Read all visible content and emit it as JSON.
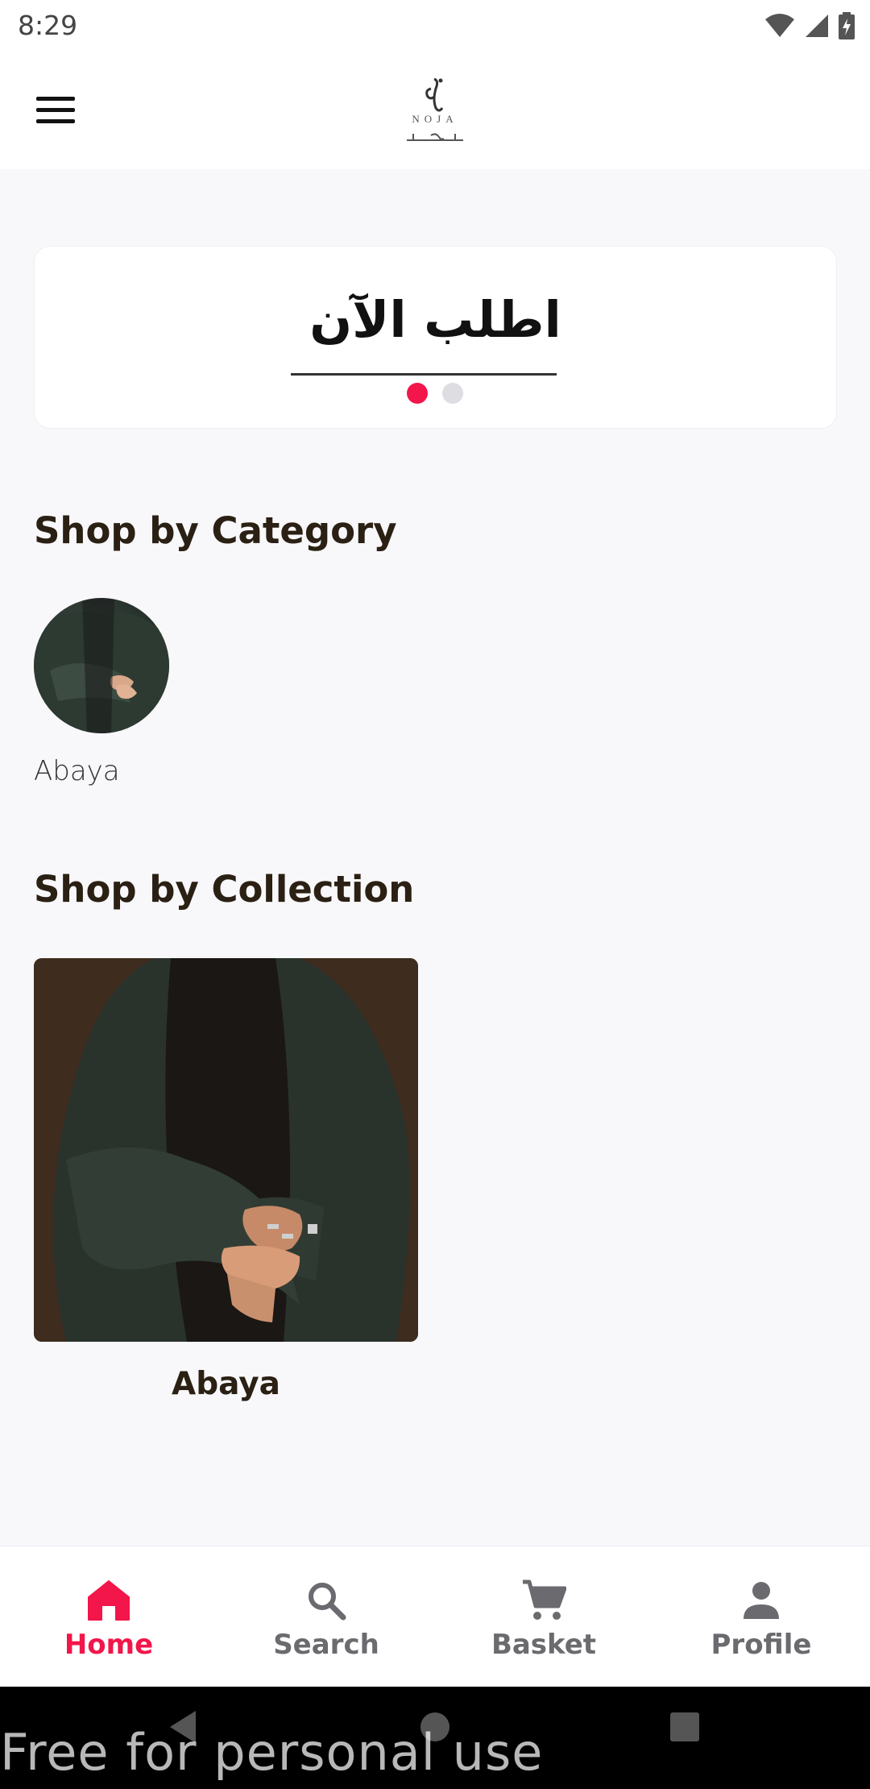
{
  "status_bar": {
    "time": "8:29"
  },
  "header": {
    "logo_text": "NOJA"
  },
  "banner": {
    "text": "اطلب الآن",
    "active_slide": 1,
    "slide_count": 2
  },
  "sections": {
    "category": {
      "title": "Shop by Category",
      "items": [
        {
          "label": "Abaya"
        }
      ]
    },
    "collection": {
      "title": "Shop by Collection",
      "items": [
        {
          "label": "Abaya"
        }
      ]
    }
  },
  "bottom_nav": {
    "items": [
      {
        "label": "Home",
        "icon": "home-icon",
        "active": true
      },
      {
        "label": "Search",
        "icon": "search-icon",
        "active": false
      },
      {
        "label": "Basket",
        "icon": "cart-icon",
        "active": false
      },
      {
        "label": "Profile",
        "icon": "profile-icon",
        "active": false
      }
    ]
  },
  "watermark": "Free for personal use",
  "colors": {
    "accent": "#f2164a",
    "inactive": "#6b6a6f",
    "title": "#2a2013",
    "background": "#f8f7fa"
  }
}
